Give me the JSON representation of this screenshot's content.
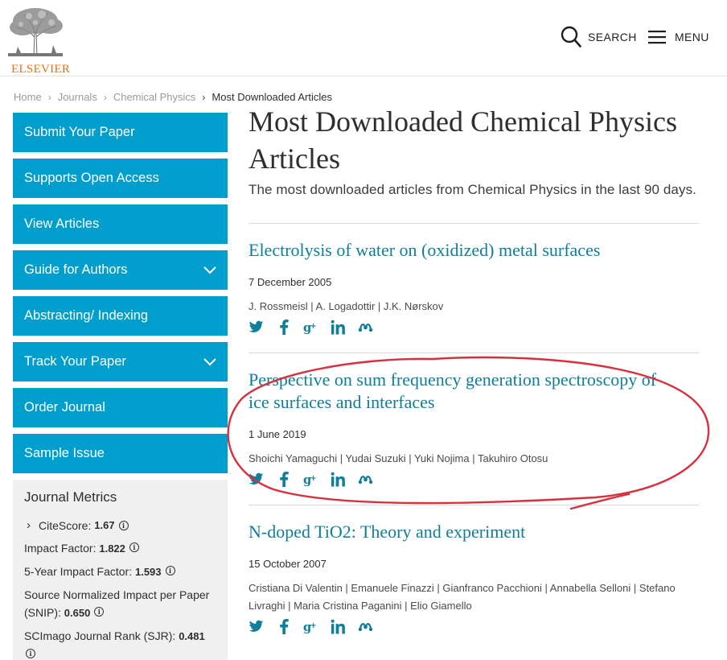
{
  "header": {
    "logo_text": "ELSEVIER",
    "search_label": "SEARCH",
    "menu_label": "MENU"
  },
  "breadcrumb": [
    "Home",
    "Journals",
    "Chemical Physics",
    "Most Downloaded Articles"
  ],
  "sidebar": {
    "items": [
      {
        "label": "Submit Your Paper",
        "has_chevron": false
      },
      {
        "label": "Supports Open Access",
        "has_chevron": false
      },
      {
        "label": "View Articles",
        "has_chevron": false
      },
      {
        "label": "Guide for Authors",
        "has_chevron": true
      },
      {
        "label": "Abstracting/ Indexing",
        "has_chevron": false
      },
      {
        "label": "Track Your Paper",
        "has_chevron": true
      },
      {
        "label": "Order Journal",
        "has_chevron": false
      },
      {
        "label": "Sample Issue",
        "has_chevron": false
      }
    ],
    "metrics": {
      "title": "Journal Metrics",
      "citescore_label": "CiteScore:",
      "citescore_value": "1.67",
      "impact_label": "Impact Factor:",
      "impact_value": "1.822",
      "five_year_label": "5-Year Impact Factor:",
      "five_year_value": "1.593",
      "snip_label_1": "Source Normalized Impact per Paper",
      "snip_label_2": "(SNIP):",
      "snip_value": "0.650",
      "sjr_label": "SCImago Journal Rank (SJR):",
      "sjr_value": "0.481"
    }
  },
  "main": {
    "title_line1": "Most Downloaded Chemical Physics",
    "title_line2": "Articles",
    "subtitle": "The most downloaded articles from Chemical Physics in the last 90 days.",
    "articles": [
      {
        "title_line1": "Electrolysis of water on (oxidized) metal surfaces",
        "title_line2": "",
        "date": "7 December 2005",
        "authors_line1": "J. Rossmeisl | A. Logadottir | J.K. Nørskov",
        "authors_line2": ""
      },
      {
        "title_line1": "Perspective on sum frequency generation spectroscopy of",
        "title_line2": "ice surfaces and interfaces",
        "date": "1 June 2019",
        "authors_line1": "Shoichi Yamaguchi | Yudai Suzuki | Yuki Nojima | Takuhiro Otosu",
        "authors_line2": ""
      },
      {
        "title_line1": "N-doped TiO2: Theory and experiment",
        "title_line2": "",
        "date": "15 October 2007",
        "authors_line1": "Cristiana Di Valentin | Emanuele Finazzi | Gianfranco Pacchioni | Annabella Selloni | Stefano",
        "authors_line2": "Livraghi | Maria Cristina Paganini | Elio Giamello"
      }
    ],
    "share_icons": [
      "twitter-icon",
      "facebook-icon",
      "google-plus-icon",
      "linkedin-icon",
      "mendeley-icon"
    ]
  },
  "colors": {
    "sidebar_blue": "#009ecc",
    "link_teal": "#0f7e9b",
    "elsevier_orange": "#e9711c",
    "annotation_red": "#d9303e"
  }
}
